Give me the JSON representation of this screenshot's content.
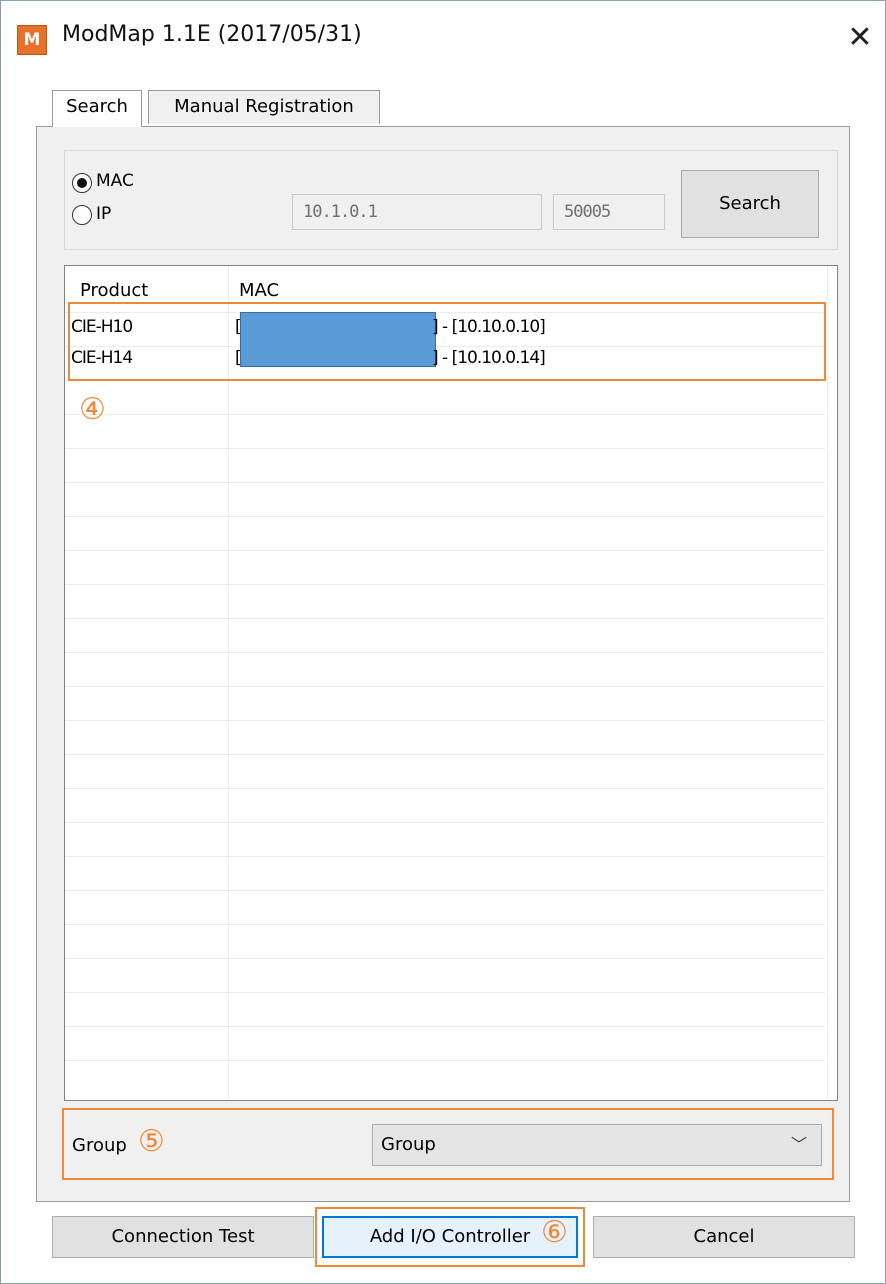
{
  "window": {
    "title": "ModMap 1.1E (2017/05/31)",
    "icon_letter": "M",
    "close_glyph": "✕"
  },
  "tabs": [
    {
      "label": "Search",
      "active": true
    },
    {
      "label": "Manual Registration",
      "active": false
    }
  ],
  "search": {
    "radio_mac_label": "MAC",
    "radio_ip_label": "IP",
    "selected_mode": "MAC",
    "ip_value": "10.1.0.1",
    "port_value": "50005",
    "search_button": "Search"
  },
  "list": {
    "columns": [
      "Product",
      "MAC"
    ],
    "rows": [
      {
        "product": "CIE-H10",
        "mac_prefix": "[",
        "mac_suffix": "] - [10.10.0.10]"
      },
      {
        "product": "CIE-H14",
        "mac_prefix": "[",
        "mac_suffix": "] - [10.10.0.14]"
      }
    ]
  },
  "group": {
    "label": "Group",
    "selected": "Group",
    "chevron": "﹀"
  },
  "buttons": {
    "connection_test": "Connection Test",
    "add_io": "Add I/O Controller",
    "cancel": "Cancel"
  },
  "callouts": {
    "list": "④",
    "group": "⑤",
    "add": "⑥"
  },
  "colors": {
    "highlight": "#ed8a3a",
    "mask": "#5b9bd5",
    "panel": "#f0f0f0"
  }
}
